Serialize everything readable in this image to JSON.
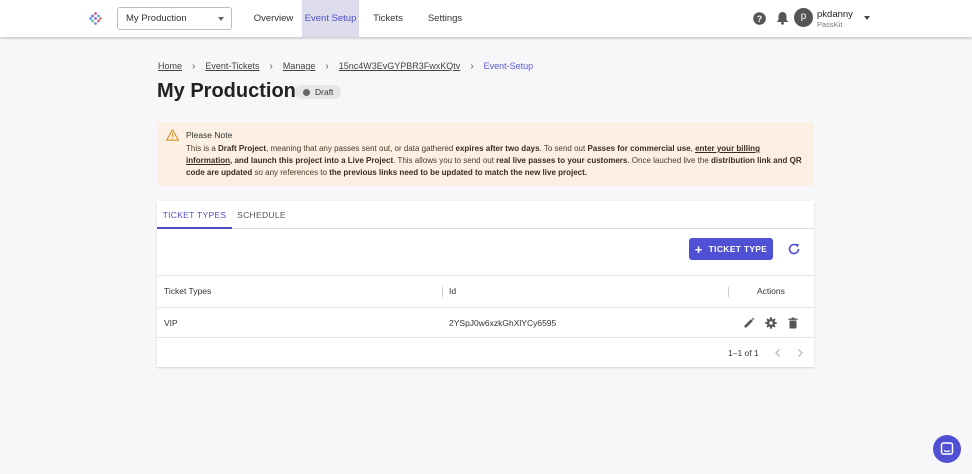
{
  "header": {
    "project_selector": "My Production",
    "nav": [
      "Overview",
      "Event Setup",
      "Tickets",
      "Settings"
    ],
    "active_nav": "Event Setup",
    "user": {
      "avatar_letter": "p",
      "name": "pkdanny",
      "company": "PassKit"
    }
  },
  "breadcrumb": [
    "Home",
    "Event-Tickets",
    "Manage",
    "15nc4W3EvGYPBR3FwxKQtv",
    "Event-Setup"
  ],
  "page": {
    "title": "My Production",
    "status": "Draft"
  },
  "notice": {
    "title": "Please Note",
    "parts": {
      "p1": "This is a ",
      "b1": "Draft Project",
      "p2": ", meaning that any passes sent out, or data gathered ",
      "b2": "expires after two days",
      "p3": ". To send out ",
      "b3": "Passes for commercial use",
      "p4": ", ",
      "link": "enter your billing information",
      "b4": ", and launch this project into a Live Project",
      "p5": ". This allows you to send out ",
      "b5": "real live passes to your customers",
      "p6": ". Once lauched live the ",
      "b6": "distribution link and QR code are updated",
      "p7": " so any references to ",
      "b7": "the previous links need to be updated to match the new live project."
    }
  },
  "tabs": [
    "TICKET TYPES",
    "SCHEDULE"
  ],
  "add_button": "TICKET TYPE",
  "table": {
    "columns": [
      "Ticket Types",
      "Id",
      "Actions"
    ],
    "rows": [
      {
        "name": "VIP",
        "id": "2YSpJ0w6xzkGhXlYCy6595"
      }
    ],
    "pagination": "1–1 of 1"
  },
  "icons": {
    "logo": "passkit-logo-icon",
    "help": "help-icon",
    "bell": "bell-icon",
    "warning": "warning-icon",
    "refresh": "refresh-icon",
    "edit": "pencil-icon",
    "settings": "gear-icon",
    "delete": "trash-icon",
    "chat": "chat-icon"
  },
  "colors": {
    "accent": "#5050d4",
    "notice_bg": "#fbf0e3",
    "active_nav_bg": "#dcdcec"
  }
}
